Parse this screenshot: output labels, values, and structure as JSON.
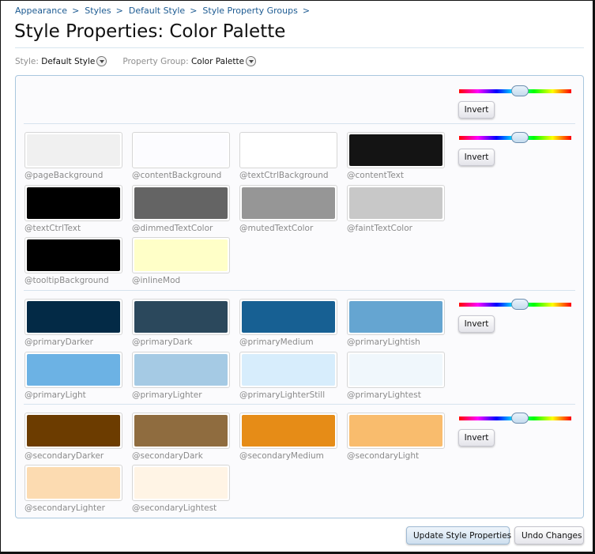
{
  "breadcrumb": [
    {
      "label": "Appearance",
      "sep": ">"
    },
    {
      "label": "Styles",
      "sep": ">"
    },
    {
      "label": "Default Style",
      "sep": ">"
    },
    {
      "label": "Style Property Groups",
      "sep": ">"
    }
  ],
  "page": {
    "title": "Style Properties: Color Palette"
  },
  "filters": {
    "style_label": "Style:",
    "style_value": "Default Style",
    "group_label": "Property Group:",
    "group_value": "Color Palette"
  },
  "invert_label": "Invert",
  "swatches": [
    {
      "name": "@pageBackground",
      "color": "#f0f0f0"
    },
    {
      "name": "@contentBackground",
      "color": "#fcfcff"
    },
    {
      "name": "@textCtrlBackground",
      "color": "#ffffff"
    },
    {
      "name": "@contentText",
      "color": "#141414"
    },
    {
      "name": "@textCtrlText",
      "color": "#000000"
    },
    {
      "name": "@dimmedTextColor",
      "color": "#646464"
    },
    {
      "name": "@mutedTextColor",
      "color": "#969696"
    },
    {
      "name": "@faintTextColor",
      "color": "#c8c8c8"
    },
    {
      "name": "@tooltipBackground",
      "color": "#000000"
    },
    {
      "name": "@inlineMod",
      "color": "#ffffc8"
    },
    {
      "name": "@primaryDarker",
      "color": "#032a46"
    },
    {
      "name": "@primaryDark",
      "color": "#2b485c"
    },
    {
      "name": "@primaryMedium",
      "color": "#176093"
    },
    {
      "name": "@primaryLightish",
      "color": "#65a5d1"
    },
    {
      "name": "@primaryLight",
      "color": "#6cb2e4"
    },
    {
      "name": "@primaryLighter",
      "color": "#a5cae4"
    },
    {
      "name": "@primaryLighterStill",
      "color": "#d7edfc"
    },
    {
      "name": "@primaryLightest",
      "color": "#f0f7fc"
    },
    {
      "name": "@secondaryDarker",
      "color": "#6c3c00"
    },
    {
      "name": "@secondaryDark",
      "color": "#8f6c3f"
    },
    {
      "name": "@secondaryMedium",
      "color": "#e68c17"
    },
    {
      "name": "@secondaryLight",
      "color": "#f9bc6d"
    },
    {
      "name": "@secondaryLighter",
      "color": "#fcdbb1"
    },
    {
      "name": "@secondaryLightest",
      "color": "#fff4e5"
    }
  ],
  "actions": {
    "update_label": "Update Style Properties",
    "undo_label": "Undo Changes"
  }
}
